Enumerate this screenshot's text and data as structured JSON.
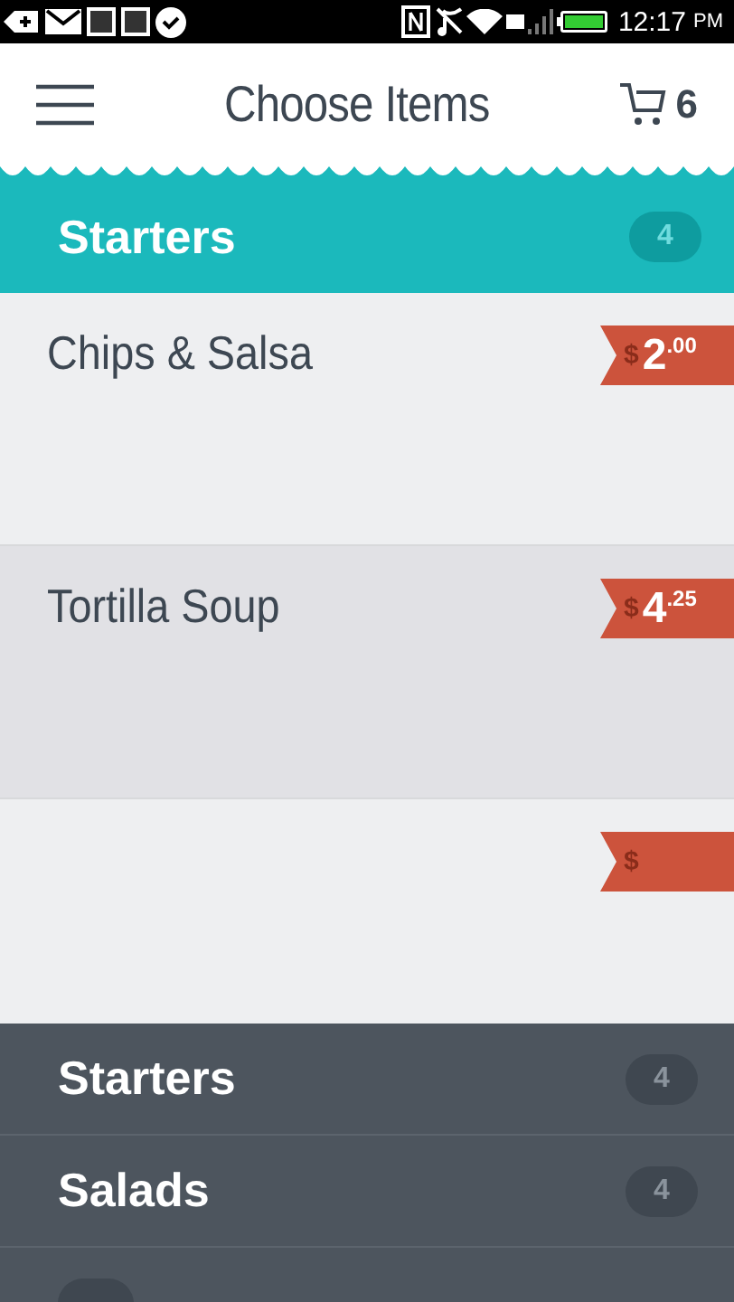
{
  "status_bar": {
    "time": "12:17",
    "meridiem": "PM"
  },
  "header": {
    "title": "Choose Items",
    "cart_count": "6"
  },
  "section": {
    "name": "Starters",
    "count": "4"
  },
  "items": [
    {
      "name": "Chips & Salsa",
      "currency": "$",
      "dollars": "2",
      "cents": ".00",
      "selected": false
    },
    {
      "name": "Tortilla Soup",
      "currency": "$",
      "dollars": "4",
      "cents": ".25",
      "selected": true
    },
    {
      "currency": "$",
      "selected": false
    }
  ],
  "categories": [
    {
      "name": "Starters",
      "count": "4"
    },
    {
      "name": "Salads",
      "count": "4"
    }
  ]
}
